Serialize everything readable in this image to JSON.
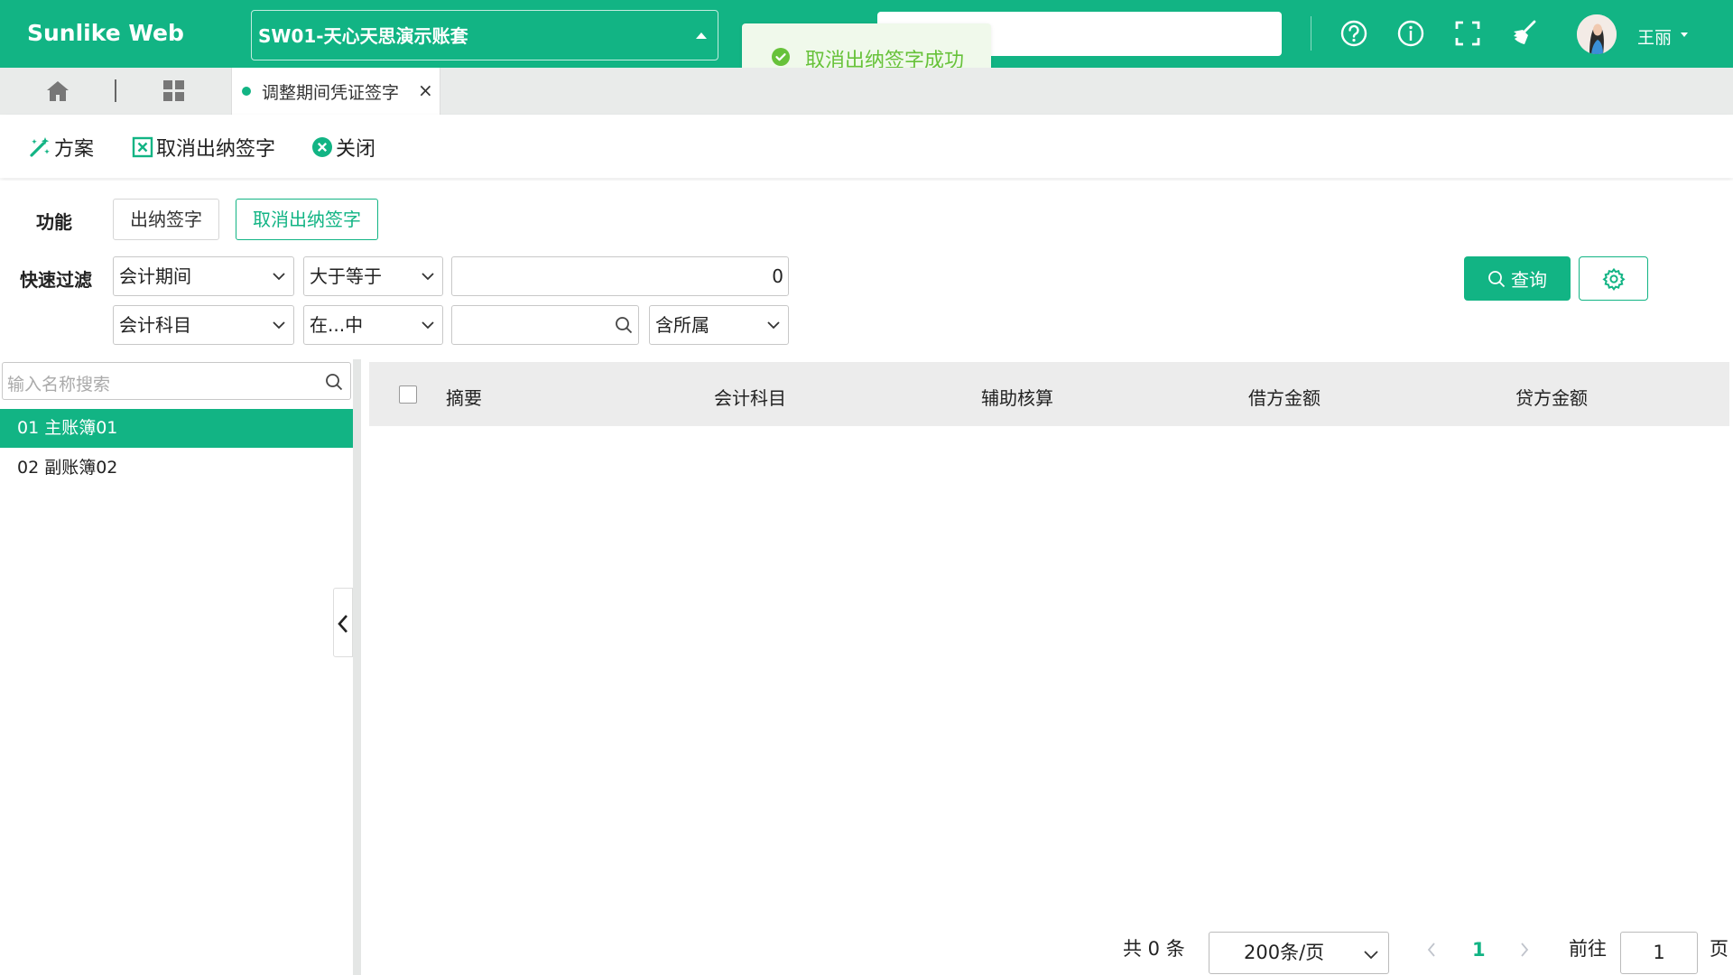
{
  "header": {
    "brand": "Sunlike Web",
    "account_set": "SW01-天心天思演示账套",
    "user_name": "王丽"
  },
  "toast": {
    "message": "取消出纳签字成功"
  },
  "tabs": [
    {
      "label": "调整期间凭证签字",
      "close": "×"
    }
  ],
  "toolbar": {
    "scheme_label": "方案",
    "cancel_cashier_sign_label": "取消出纳签字",
    "close_label": "关闭"
  },
  "filter": {
    "function_label": "功能",
    "function_options": [
      "出纳签字",
      "取消出纳签字"
    ],
    "function_selected": "取消出纳签字",
    "quick_filter_label": "快速过滤",
    "row1": {
      "field": "会计期间",
      "operator": "大于等于",
      "value": "0"
    },
    "row2": {
      "field": "会计科目",
      "operator": "在...中",
      "value": "",
      "scope": "含所属"
    },
    "query_label": "查询"
  },
  "left_panel": {
    "search_placeholder": "输入名称搜索",
    "books": [
      {
        "label": "01 主账簿01",
        "selected": true
      },
      {
        "label": "02 副账簿02",
        "selected": false
      }
    ]
  },
  "grid": {
    "columns": [
      "摘要",
      "会计科目",
      "辅助核算",
      "借方金额",
      "贷方金额"
    ],
    "rows": []
  },
  "pager": {
    "total_text": "共 0 条",
    "page_size": "200条/页",
    "current_page": "1",
    "goto_label": "前往",
    "goto_value": "1",
    "page_unit": "页"
  },
  "colors": {
    "brand": "#12b484",
    "toast_bg": "#f0f9eb",
    "toast_text": "#67c23a"
  }
}
